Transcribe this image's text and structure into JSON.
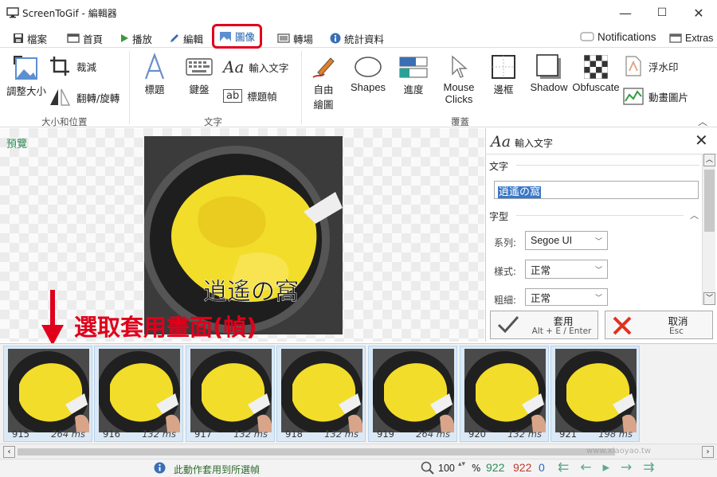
{
  "window": {
    "title": "ScreenToGif - 編輯器",
    "min": "—",
    "max": "☐",
    "close": "✕"
  },
  "tabs": [
    {
      "label": "檔案",
      "icon": "save-icon"
    },
    {
      "label": "首頁",
      "icon": "home-icon"
    },
    {
      "label": "播放",
      "icon": "play-icon"
    },
    {
      "label": "編輯",
      "icon": "pencil-icon"
    },
    {
      "label": "圖像",
      "icon": "image-icon"
    },
    {
      "label": "轉場",
      "icon": "transition-icon"
    },
    {
      "label": "統計資料",
      "icon": "info-icon"
    }
  ],
  "top_right": {
    "notifications": "Notifications",
    "extras": "Extras"
  },
  "ribbon": {
    "size_group": {
      "resize": "調整大小",
      "crop": "裁減",
      "flip": "翻轉/旋轉",
      "label": "大小和位置"
    },
    "text_group": {
      "caption": "標題",
      "keyboard": "鍵盤",
      "input_text": "輸入文字",
      "title_frame": "標題幀",
      "label": "文字"
    },
    "overlay_group": {
      "freehand_1": "自由",
      "freehand_2": "繪圖",
      "shapes": "Shapes",
      "progress": "進度",
      "mouse_1": "Mouse",
      "mouse_2": "Clicks",
      "border": "邊框",
      "shadow": "Shadow",
      "obfuscate": "Obfuscate",
      "watermark": "浮水印",
      "cinemagraph": "動畫圖片",
      "label": "覆蓋"
    }
  },
  "preview": {
    "label": "預覽",
    "overlay_text": "逍遙の窩",
    "annotation": "選取套用畫面(幀)"
  },
  "panel": {
    "title": "輸入文字",
    "text_section": "文字",
    "text_value": "逍遙の窩",
    "font_section": "字型",
    "family_label": "系列:",
    "family_value": "Segoe UI",
    "style_label": "樣式:",
    "style_value": "正常",
    "weight_label": "粗細:",
    "weight_value": "正常",
    "apply": "套用",
    "apply_shortcut": "Alt + E / Enter",
    "cancel": "取消",
    "cancel_shortcut": "Esc"
  },
  "frames": [
    {
      "num": "915",
      "ms": "264 ms"
    },
    {
      "num": "916",
      "ms": "132 ms"
    },
    {
      "num": "917",
      "ms": "132 ms"
    },
    {
      "num": "918",
      "ms": "132 ms"
    },
    {
      "num": "919",
      "ms": "264 ms"
    },
    {
      "num": "920",
      "ms": "132 ms"
    },
    {
      "num": "921",
      "ms": "198 ms"
    }
  ],
  "status": {
    "message": "此動作套用到所選幀",
    "zoom": "100",
    "percent": "%",
    "total": "922",
    "selected": "922",
    "count": "0",
    "watermark": "www.xiaoyao.tw"
  },
  "colors": {
    "accent": "#1c5fa8",
    "highlight_red": "#e0001b",
    "green": "#2e8b57"
  }
}
